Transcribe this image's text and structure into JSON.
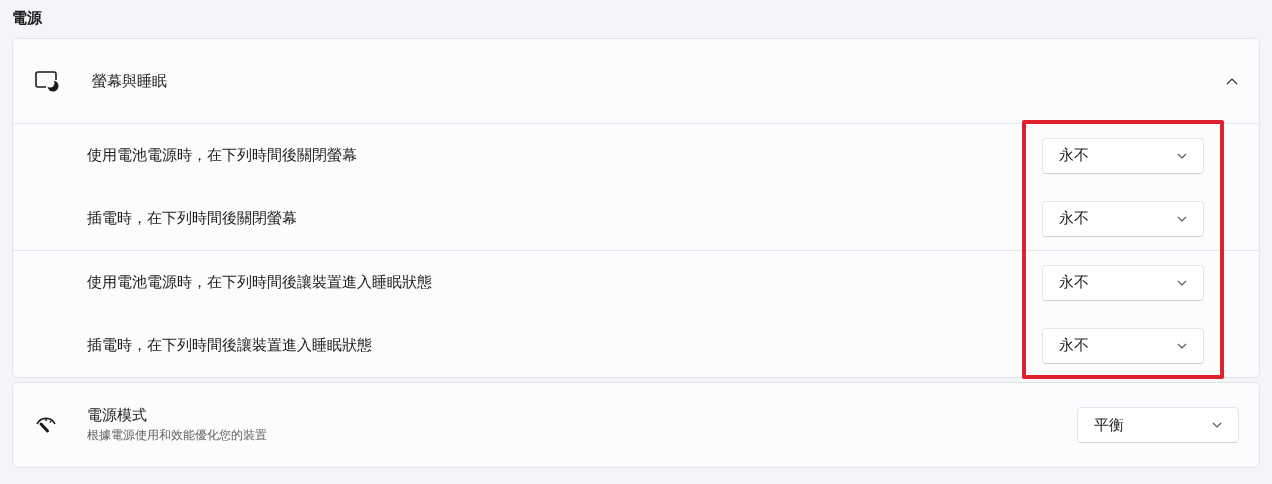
{
  "section_title": "電源",
  "screen_sleep": {
    "title": "螢幕與睡眠",
    "expanded": true,
    "groups": [
      {
        "settings": [
          {
            "label": "使用電池電源時，在下列時間後關閉螢幕",
            "value": "永不"
          },
          {
            "label": "插電時，在下列時間後關閉螢幕",
            "value": "永不"
          }
        ]
      },
      {
        "settings": [
          {
            "label": "使用電池電源時，在下列時間後讓裝置進入睡眠狀態",
            "value": "永不"
          },
          {
            "label": "插電時，在下列時間後讓裝置進入睡眠狀態",
            "value": "永不"
          }
        ]
      }
    ]
  },
  "power_mode": {
    "title": "電源模式",
    "description": "根據電源使用和效能優化您的裝置",
    "value": "平衡"
  }
}
